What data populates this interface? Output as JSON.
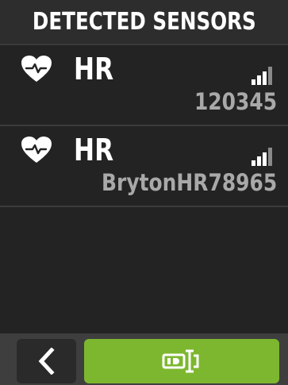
{
  "header": {
    "title": "DETECTED SENSORS"
  },
  "sensors": [
    {
      "type": "HR",
      "id": "120345",
      "icon": "heart-rate-icon",
      "signal_icon": "signal-strength-icon"
    },
    {
      "type": "HR",
      "id": "BrytonHR78965",
      "icon": "heart-rate-icon",
      "signal_icon": "signal-strength-icon"
    }
  ],
  "footer": {
    "back_icon": "chevron-left-icon",
    "id_icon": "sensor-id-icon"
  },
  "colors": {
    "background": "#232323",
    "header_bg": "#2d2d2d",
    "text_primary": "#ffffff",
    "text_secondary": "#a9a9a9",
    "accent_green": "#7db72f",
    "footer_bg": "#3e3e3e"
  }
}
